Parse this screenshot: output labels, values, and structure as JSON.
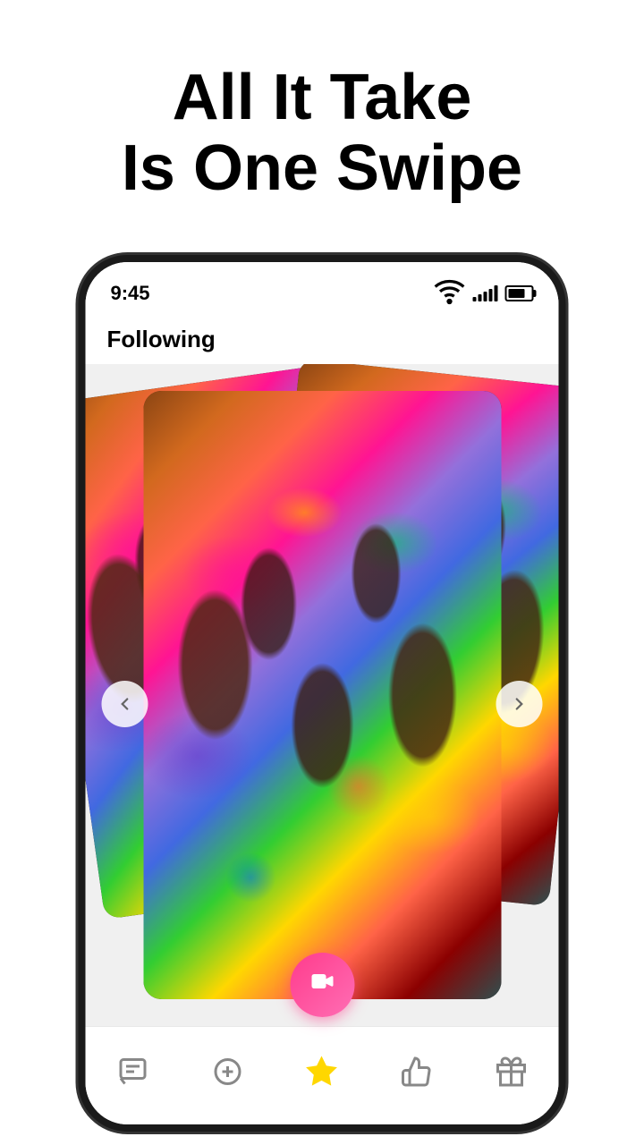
{
  "hero": {
    "line1": "All It Take",
    "line2": "Is One Swipe"
  },
  "phone": {
    "statusBar": {
      "time": "9:45",
      "wifi": true,
      "signal": 4,
      "battery": 75
    },
    "header": {
      "title": "Following"
    },
    "nav": {
      "leftArrow": "←",
      "rightArrow": "→"
    },
    "bottomNav": {
      "items": [
        {
          "name": "chat",
          "label": "Chat",
          "active": false
        },
        {
          "name": "add",
          "label": "Add",
          "active": false
        },
        {
          "name": "star",
          "label": "Star",
          "active": true
        },
        {
          "name": "like",
          "label": "Like",
          "active": false
        },
        {
          "name": "gift",
          "label": "Gift",
          "active": false
        }
      ]
    }
  }
}
